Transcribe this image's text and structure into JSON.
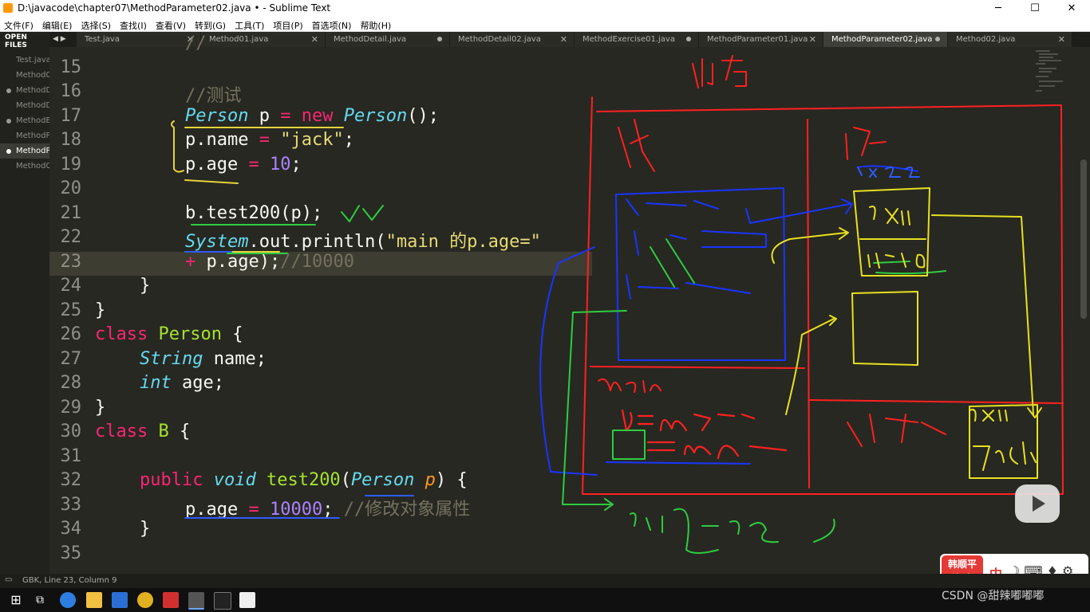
{
  "window": {
    "title": "D:\\javacode\\chapter07\\MethodParameter02.java • - Sublime Text",
    "minimize": "─",
    "maximize": "☐",
    "close": "✕"
  },
  "menu": [
    "文件(F)",
    "编辑(E)",
    "选择(S)",
    "查找(I)",
    "查看(V)",
    "转到(G)",
    "工具(T)",
    "项目(P)",
    "首选项(N)",
    "帮助(H)"
  ],
  "sidebar": {
    "header": "OPEN FILES",
    "items": [
      "Test.java",
      "Method0",
      "MethodD",
      "MethodD",
      "MethodE",
      "MethodP",
      "MethodP",
      "Method0"
    ]
  },
  "tabs": [
    "Test.java",
    "Method01.java",
    "MethodDetail.java",
    "MethodDetail02.java",
    "MethodExercise01.java",
    "MethodParameter01.java",
    "MethodParameter02.java",
    "Method02.java"
  ],
  "line_numbers": [
    "15",
    "16",
    "17",
    "18",
    "19",
    "20",
    "21",
    "22",
    "23",
    "24",
    "25",
    "26",
    "27",
    "28",
    "29",
    "30",
    "31",
    "32",
    "33",
    "34",
    "35"
  ],
  "code": {
    "l15": "//",
    "l16": "//测试",
    "l17a": "Person",
    "l17b": " p ",
    "l17c": "=",
    "l17d": " new ",
    "l17e": "Person",
    "l17f": "();",
    "l18a": "p.name ",
    "l18b": "=",
    "l18c": " \"jack\"",
    "l18d": ";",
    "l19a": "p.age ",
    "l19b": "=",
    "l19c": " 10",
    "l19d": ";",
    "l21": "b.test200(p);",
    "l22a": "System",
    "l22b": ".out.println(",
    "l22c": "\"main 的p.age=\"",
    "l23a": "+",
    "l23b": " p.age);",
    "l23c": "//10000",
    "l24": "}",
    "l25": "}",
    "l26a": "class",
    "l26b": " Person",
    "l26c": " {",
    "l27a": "String",
    "l27b": " name;",
    "l28a": "int",
    "l28b": " age;",
    "l29": "}",
    "l30a": "class",
    "l30b": " B",
    "l30c": " {",
    "l32a": "public",
    "l32b": " void",
    "l32c": " test200",
    "l32d": "(",
    "l32e": "Person",
    "l32f": " p",
    "l32g": ") {",
    "l33a": "p.age ",
    "l33b": "=",
    "l33c": " 10000",
    "l33d": "; ",
    "l33e": "//修改对象属性",
    "l34": "}"
  },
  "status": "GBK, Line 23, Column 9",
  "logo": {
    "line1": "韩顺平",
    "line2": "教 育",
    "zh": "中"
  },
  "watermark": "CSDN @甜辣嘟嘟嘟"
}
